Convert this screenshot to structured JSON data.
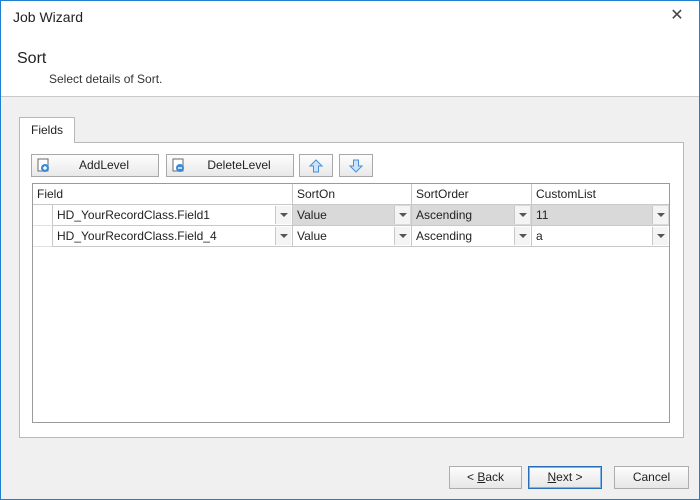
{
  "window": {
    "title": "Job Wizard"
  },
  "header": {
    "title": "Sort",
    "subtitle": "Select details of Sort."
  },
  "tabs": [
    {
      "label": "Fields"
    }
  ],
  "toolbar": {
    "add_label": "AddLevel",
    "delete_label": "DeleteLevel"
  },
  "grid": {
    "columns": [
      "Field",
      "SortOn",
      "SortOrder",
      "CustomList"
    ],
    "rows": [
      {
        "field": "HD_YourRecordClass.Field1",
        "sorton": "Value",
        "sortorder": "Ascending",
        "customlist": "11"
      },
      {
        "field": "HD_YourRecordClass.Field_4",
        "sorton": "Value",
        "sortorder": "Ascending",
        "customlist": "a"
      }
    ]
  },
  "buttons": {
    "back": {
      "prefix": "< ",
      "mnemonic": "B",
      "rest": "ack"
    },
    "next": {
      "mnemonic": "N",
      "rest": "ext >"
    },
    "cancel": "Cancel"
  },
  "colors": {
    "accent": "#1f7fd0",
    "selected_cell": "#d9d9d9",
    "arrow_icon": "#4a8fd9"
  }
}
